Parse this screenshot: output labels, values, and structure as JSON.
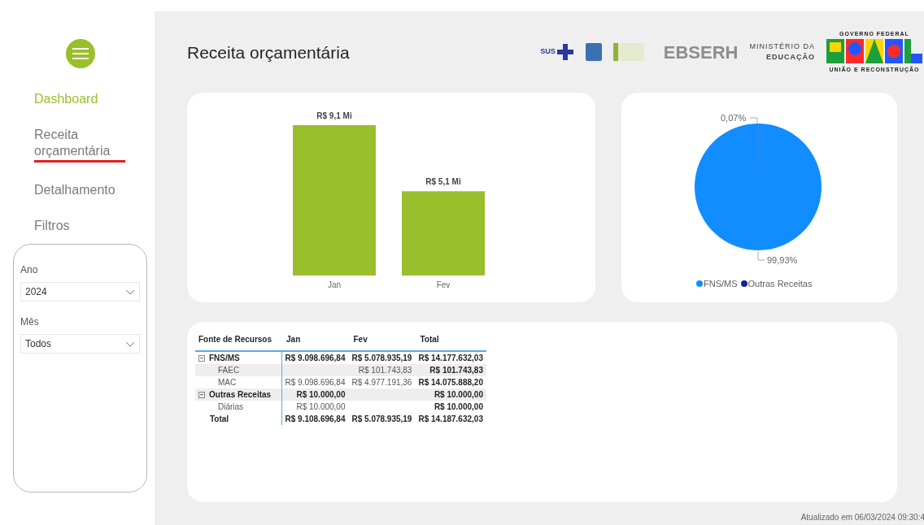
{
  "sidebar": {
    "nav": [
      {
        "label": "Dashboard",
        "kind": "home",
        "selected": false
      },
      {
        "label": "Receita orçamentária",
        "kind": "page",
        "selected": true
      },
      {
        "label": "Detalhamento",
        "kind": "page",
        "selected": false
      },
      {
        "label": "Filtros",
        "kind": "page",
        "selected": false
      }
    ],
    "filters": [
      {
        "label": "Ano",
        "value": "2024"
      },
      {
        "label": "Mês",
        "value": "Todos"
      }
    ]
  },
  "header": {
    "title": "Receita orçamentária",
    "logos": {
      "sus": "SUS",
      "ebserh": "EBSERH",
      "ministerio": [
        "MINISTÉRIO DA",
        "EDUCAÇÃO"
      ],
      "governo_top": "GOVERNO FEDERAL",
      "governo_bottom": "UNIÃO E RECONSTRUÇÃO"
    }
  },
  "bar_chart": {
    "chart_data": {
      "type": "bar",
      "categories": [
        "Jan",
        "Fev"
      ],
      "values": [
        9.1,
        5.1
      ],
      "color": "#99bf2d",
      "value_labels": [
        "R$ 9,1 Mi",
        "R$ 5,1 Mi"
      ]
    }
  },
  "pie_chart": {
    "chart_data": {
      "type": "pie",
      "categories": [
        "FNS/MS",
        "Outras Receitas"
      ],
      "values": [
        99.93,
        0.07
      ],
      "legend": true,
      "colors": [
        "#118dff",
        "#12239e"
      ],
      "value_labels": [
        "99,93%",
        "0,07%"
      ]
    }
  },
  "table": {
    "columns": [
      "Fonte de Recursos",
      "Jan",
      "Fev",
      "Total"
    ],
    "rows": [
      {
        "kind": "group",
        "expanded": true,
        "cells": [
          "FNS/MS",
          "R$ 9.098.696,84",
          "R$ 5.078.935,19",
          "R$ 14.177.632,03"
        ]
      },
      {
        "kind": "child",
        "cells": [
          "FAEC",
          "",
          "R$ 101.743,83",
          "R$ 101.743,83"
        ]
      },
      {
        "kind": "child",
        "cells": [
          "MAC",
          "R$ 9.098.696,84",
          "R$ 4.977.191,36",
          "R$ 14.075.888,20"
        ]
      },
      {
        "kind": "group",
        "expanded": true,
        "cells": [
          "Outras Receitas",
          "R$ 10.000,00",
          "",
          "R$ 10.000,00"
        ]
      },
      {
        "kind": "child",
        "cells": [
          "Diárias",
          "R$ 10.000,00",
          "",
          "R$ 10.000,00"
        ]
      },
      {
        "kind": "total",
        "cells": [
          "Total",
          "R$ 9.108.696,84",
          "R$ 5.078.935,19",
          "R$ 14.187.632,03"
        ]
      }
    ]
  },
  "footer": "Atualizado em 06/03/2024 09:30:4"
}
